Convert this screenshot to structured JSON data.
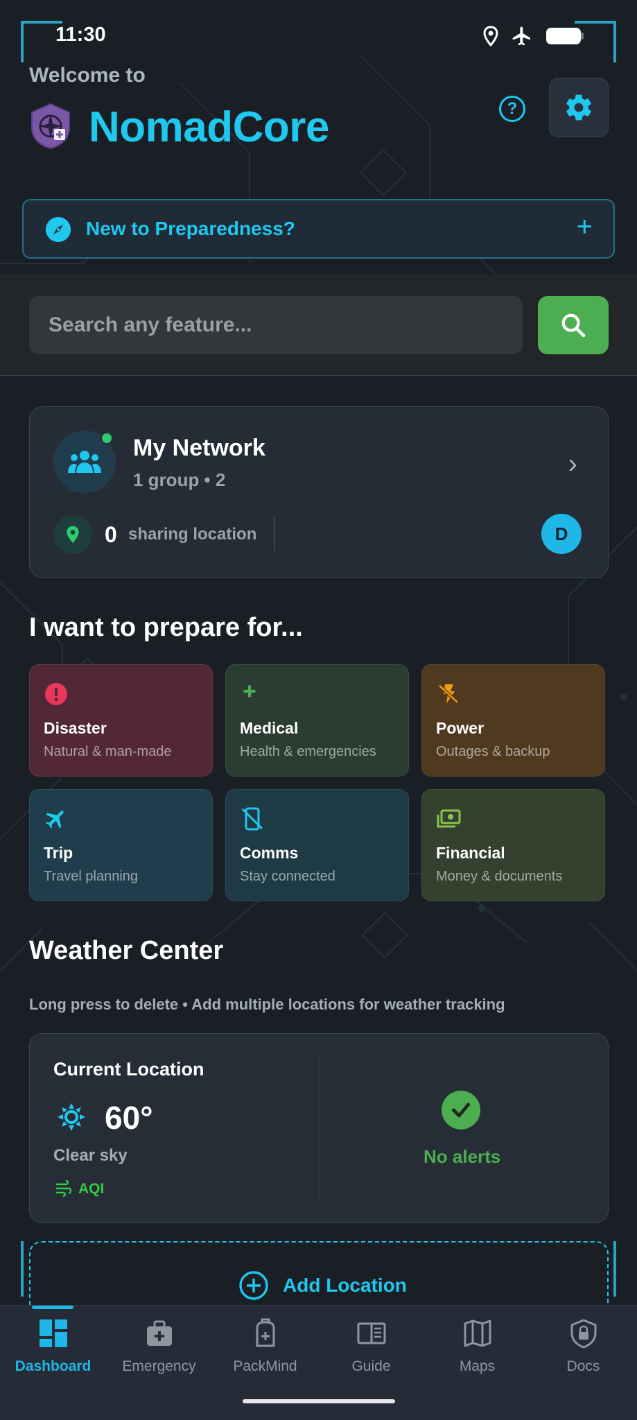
{
  "status_bar": {
    "time": "11:30",
    "icons": [
      "location-icon",
      "airplane-icon",
      "battery-icon"
    ]
  },
  "header": {
    "welcome": "Welcome to",
    "title": "NomadCore",
    "help_label": "?"
  },
  "banner": {
    "label": "New to Preparedness?",
    "action": "+"
  },
  "search": {
    "placeholder": "Search any feature..."
  },
  "network": {
    "title": "My Network",
    "subtitle": "1 group • 2",
    "sharing_count": "0",
    "sharing_label": "sharing location",
    "member_initial": "D"
  },
  "prepare": {
    "title": "I want to prepare for...",
    "tiles": [
      {
        "title": "Disaster",
        "subtitle": "Natural & man-made",
        "icon": "alert-icon",
        "color": "#522836"
      },
      {
        "title": "Medical",
        "subtitle": "Health & emergencies",
        "icon": "medical-plus-icon",
        "color": "#2b3c32"
      },
      {
        "title": "Power",
        "subtitle": "Outages & backup",
        "icon": "power-off-icon",
        "color": "#4f3a20"
      },
      {
        "title": "Trip",
        "subtitle": "Travel planning",
        "icon": "airplane-icon",
        "color": "#1f3d4a"
      },
      {
        "title": "Comms",
        "subtitle": "Stay connected",
        "icon": "phone-off-icon",
        "color": "#1e3a45"
      },
      {
        "title": "Financial",
        "subtitle": "Money & documents",
        "icon": "money-icon",
        "color": "#34412e"
      }
    ]
  },
  "weather": {
    "title": "Weather Center",
    "hint": "Long press to delete • Add multiple locations for weather tracking",
    "location": "Current Location",
    "temperature": "60°",
    "condition": "Clear sky",
    "aqi": "AQI",
    "alerts": "No alerts",
    "add_label": "Add Location"
  },
  "nav": {
    "items": [
      {
        "label": "Dashboard",
        "icon": "dashboard-icon",
        "active": true
      },
      {
        "label": "Emergency",
        "icon": "medkit-icon",
        "active": false
      },
      {
        "label": "PackMind",
        "icon": "backpack-icon",
        "active": false
      },
      {
        "label": "Guide",
        "icon": "book-icon",
        "active": false
      },
      {
        "label": "Maps",
        "icon": "map-icon",
        "active": false
      },
      {
        "label": "Docs",
        "icon": "lock-shield-icon",
        "active": false
      }
    ]
  },
  "colors": {
    "accent": "#1ec8ee",
    "background": "#1a1f25",
    "success": "#4cae50",
    "danger": "#e8365d",
    "warning": "#f39c12"
  }
}
